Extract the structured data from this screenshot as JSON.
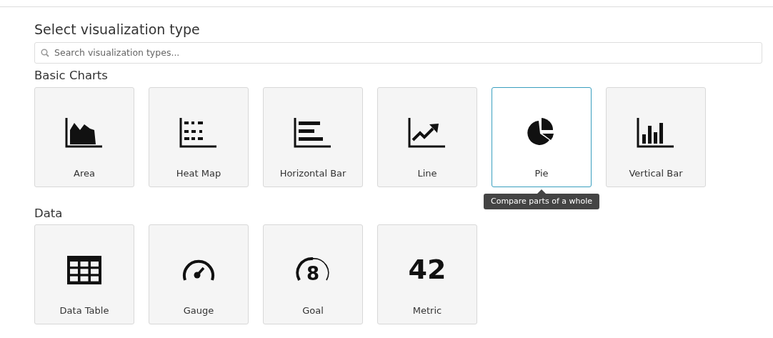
{
  "title": "Select visualization type",
  "search": {
    "placeholder": "Search visualization types..."
  },
  "sections": [
    {
      "heading": "Basic Charts",
      "items": [
        {
          "label": "Area",
          "kind": "area",
          "selected": false
        },
        {
          "label": "Heat Map",
          "kind": "heatmap",
          "selected": false
        },
        {
          "label": "Horizontal Bar",
          "kind": "hbar",
          "selected": false
        },
        {
          "label": "Line",
          "kind": "line",
          "selected": false
        },
        {
          "label": "Pie",
          "kind": "pie",
          "selected": true,
          "tooltip": "Compare parts of a whole"
        },
        {
          "label": "Vertical Bar",
          "kind": "vbar",
          "selected": false
        }
      ]
    },
    {
      "heading": "Data",
      "items": [
        {
          "label": "Data Table",
          "kind": "table",
          "selected": false
        },
        {
          "label": "Gauge",
          "kind": "gauge",
          "selected": false
        },
        {
          "label": "Goal",
          "kind": "goal",
          "selected": false,
          "icon_text": "8"
        },
        {
          "label": "Metric",
          "kind": "metric",
          "selected": false,
          "icon_text": "42"
        }
      ]
    }
  ]
}
